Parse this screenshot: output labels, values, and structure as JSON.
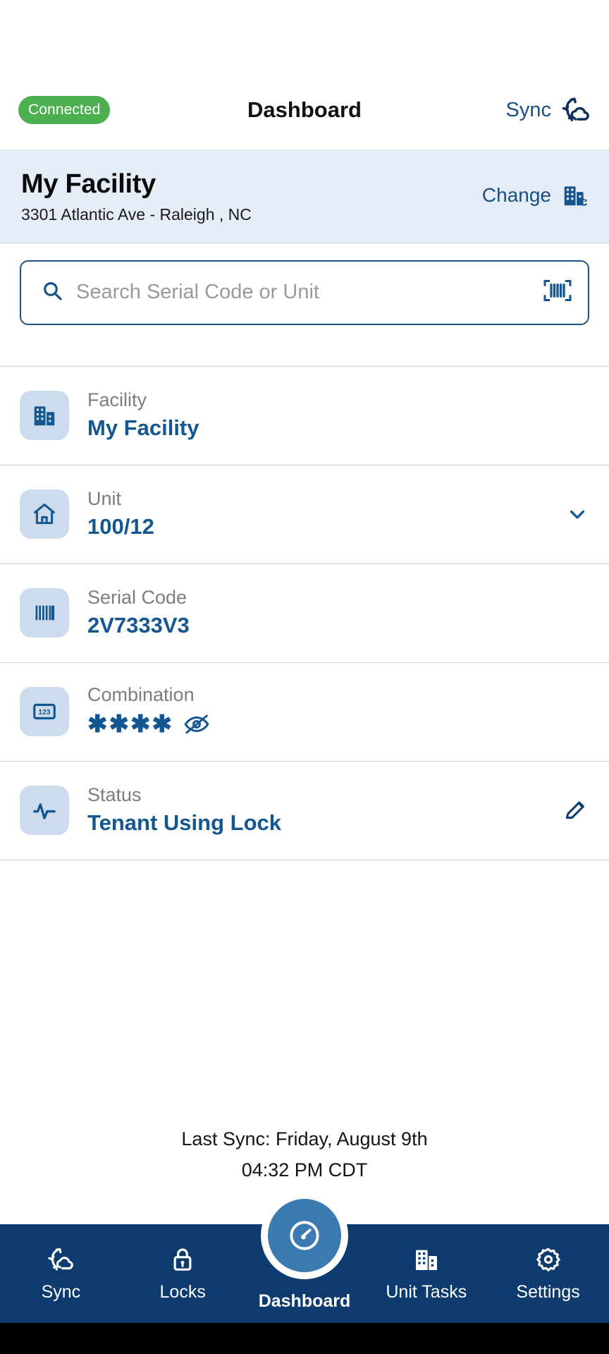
{
  "appbar": {
    "connection_badge": "Connected",
    "title": "Dashboard",
    "sync_label": "Sync",
    "sync_icon": "cloud-sync-icon"
  },
  "facility_banner": {
    "name": "My Facility",
    "address": "3301 Atlantic Ave - Raleigh , NC",
    "change_label": "Change",
    "change_icon": "building-swap-icon"
  },
  "search": {
    "placeholder": "Search Serial Code or Unit",
    "value": "",
    "search_icon": "search-icon",
    "scan_icon": "barcode-scan-icon"
  },
  "details": [
    {
      "icon": "building-icon",
      "label": "Facility",
      "value": "My Facility",
      "trailing": ""
    },
    {
      "icon": "home-icon",
      "label": "Unit",
      "value": "100/12",
      "trailing": "chevron-down-icon"
    },
    {
      "icon": "barcode-icon",
      "label": "Serial Code",
      "value": "2V7333V3",
      "trailing": ""
    },
    {
      "icon": "numeric-123-icon",
      "label": "Combination",
      "value": "✱✱✱✱",
      "trailing": "eye-off-icon"
    },
    {
      "icon": "pulse-icon",
      "label": "Status",
      "value": "Tenant Using Lock",
      "trailing": "pencil-icon"
    }
  ],
  "last_sync": {
    "line1": "Last Sync: Friday, August 9th",
    "line2": "04:32 PM CDT"
  },
  "bottom_nav": {
    "items": [
      {
        "label": "Sync",
        "icon": "cloud-sync-icon",
        "active": false
      },
      {
        "label": "Locks",
        "icon": "lock-icon",
        "active": false
      },
      {
        "label": "Dashboard",
        "icon": "gauge-icon",
        "active": true
      },
      {
        "label": "Unit Tasks",
        "icon": "building-icon",
        "active": false
      },
      {
        "label": "Settings",
        "icon": "gear-icon",
        "active": false
      }
    ]
  },
  "colors": {
    "brand_navy": "#0d3b70",
    "link_blue": "#1a4f86",
    "value_blue": "#14568f",
    "banner_bg": "#e4ecf5",
    "badge_green": "#4caf50",
    "fab_blue": "#3b7ab0"
  }
}
